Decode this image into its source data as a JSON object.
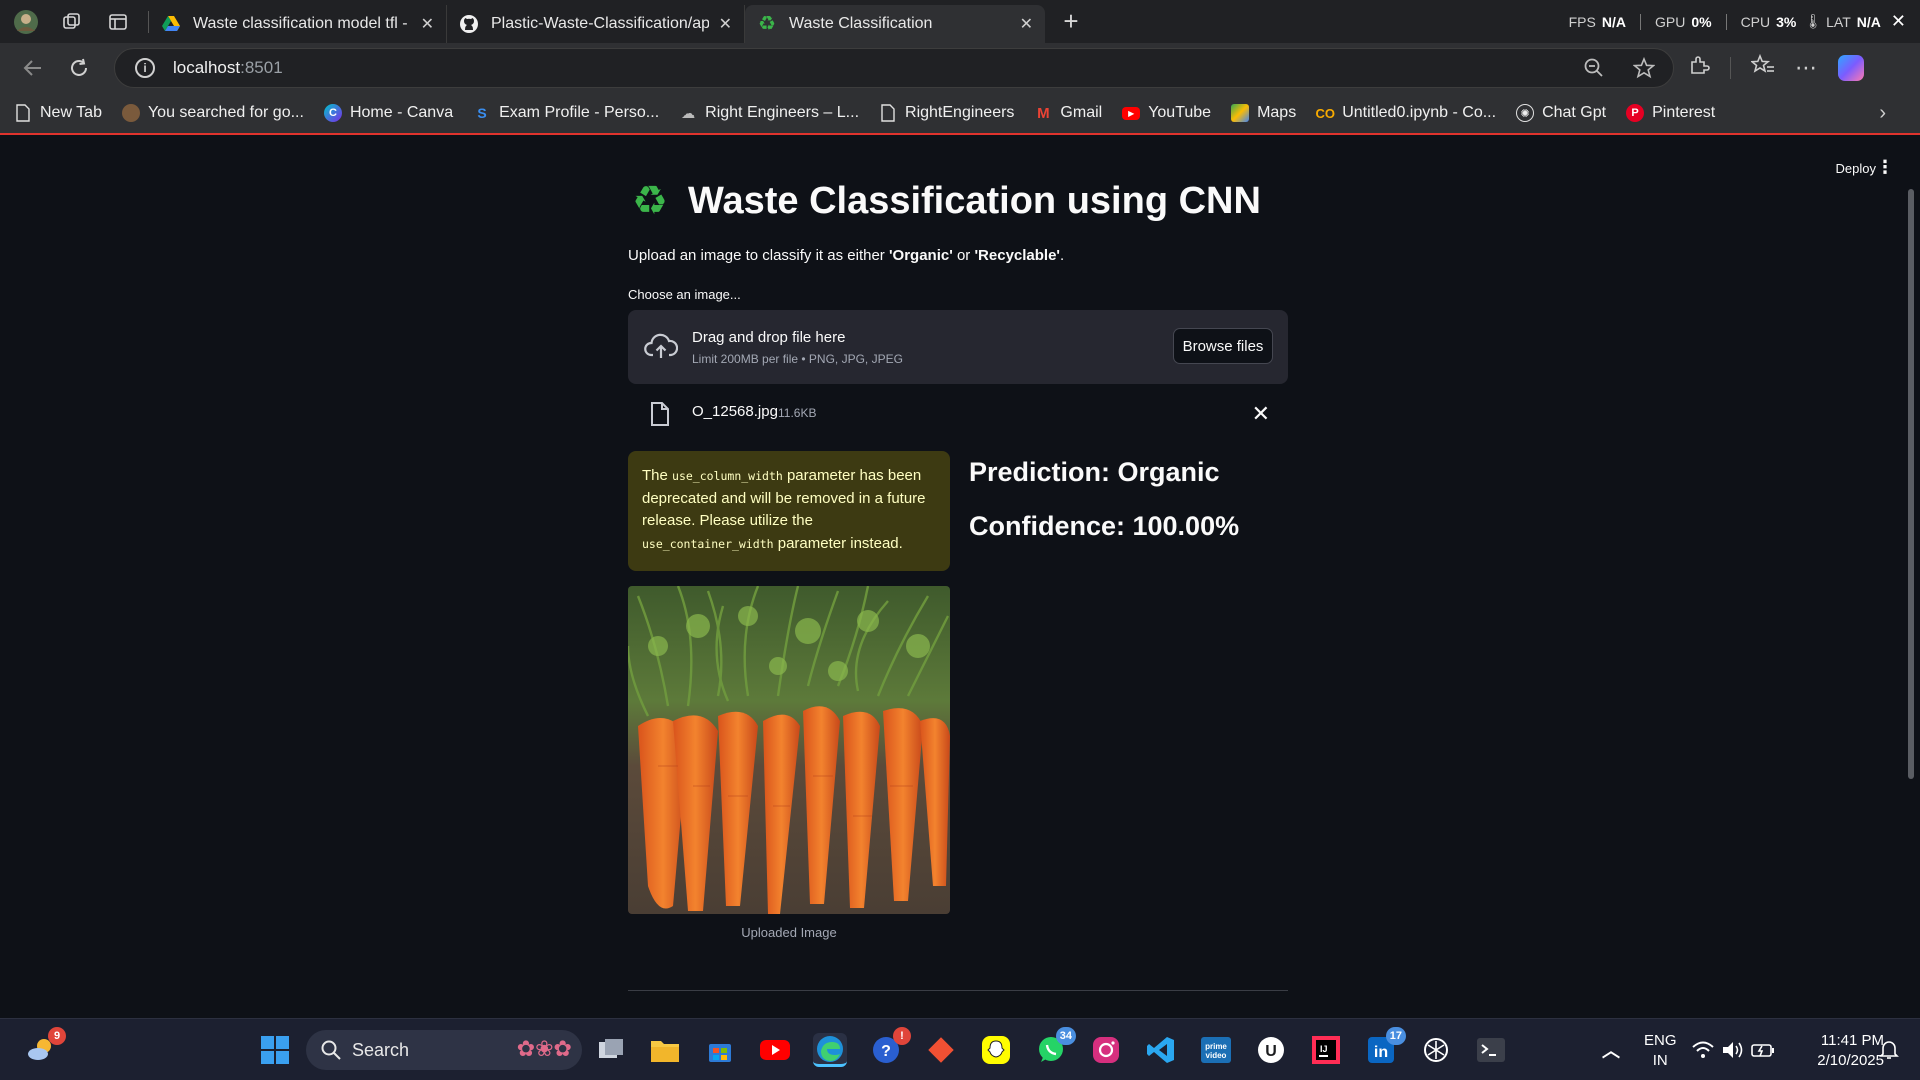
{
  "browser": {
    "tabs": [
      {
        "title": "Waste classification model tfl - Go",
        "icon": "google-drive-icon",
        "active": false
      },
      {
        "title": "Plastic-Waste-Classification/app.p",
        "icon": "github-icon",
        "active": false
      },
      {
        "title": "Waste Classification",
        "icon": "recycle-icon",
        "active": true
      }
    ],
    "perf": {
      "fps_label": "FPS",
      "fps": "N/A",
      "gpu_label": "GPU",
      "gpu": "0%",
      "cpu_label": "CPU",
      "cpu": "3%",
      "lat_label": "LAT",
      "lat": "N/A"
    },
    "url_host": "localhost",
    "url_port": ":8501",
    "bookmarks": [
      {
        "label": "New Tab",
        "icon": "page-icon"
      },
      {
        "label": "You searched for go...",
        "icon": "site-icon"
      },
      {
        "label": "Home - Canva",
        "icon": "canva-icon"
      },
      {
        "label": "Exam Profile - Perso...",
        "icon": "site-icon"
      },
      {
        "label": "Right Engineers – L...",
        "icon": "site-icon"
      },
      {
        "label": "RightEngineers",
        "icon": "page-icon"
      },
      {
        "label": "Gmail",
        "icon": "gmail-icon"
      },
      {
        "label": "YouTube",
        "icon": "youtube-icon"
      },
      {
        "label": "Maps",
        "icon": "maps-icon"
      },
      {
        "label": "Untitled0.ipynb - Co...",
        "icon": "colab-icon"
      },
      {
        "label": "Chat Gpt",
        "icon": "chatgpt-icon"
      },
      {
        "label": "Pinterest",
        "icon": "pinterest-icon"
      }
    ]
  },
  "app": {
    "deploy_label": "Deploy",
    "title": "Waste Classification using CNN",
    "subtitle_prefix": "Upload an image to classify it as either ",
    "subtitle_organic": "'Organic'",
    "subtitle_or": " or ",
    "subtitle_recyclable": "'Recyclable'",
    "subtitle_end": ".",
    "uploader_label": "Choose an image...",
    "dropzone_title": "Drag and drop file here",
    "dropzone_limit": "Limit 200MB per file • PNG, JPG, JPEG",
    "browse_label": "Browse files",
    "file_name": "O_12568.jpg",
    "file_size": "11.6KB",
    "warning": {
      "p1": "The ",
      "code1": "use_column_width",
      "p2": " parameter has been deprecated and will be removed in a future release. Please utilize the ",
      "code2": "use_container_width",
      "p3": " parameter instead."
    },
    "prediction": "Prediction: Organic",
    "confidence": "Confidence: 100.00%",
    "image_caption": "Uploaded Image"
  },
  "taskbar": {
    "weather_badge": "9",
    "search_placeholder": "Search",
    "badges": {
      "copilot_alert": "!",
      "whatsapp": "34",
      "linkedin": "17"
    },
    "language": "ENG",
    "region": "IN",
    "time": "11:41 PM",
    "date": "2/10/2025"
  }
}
